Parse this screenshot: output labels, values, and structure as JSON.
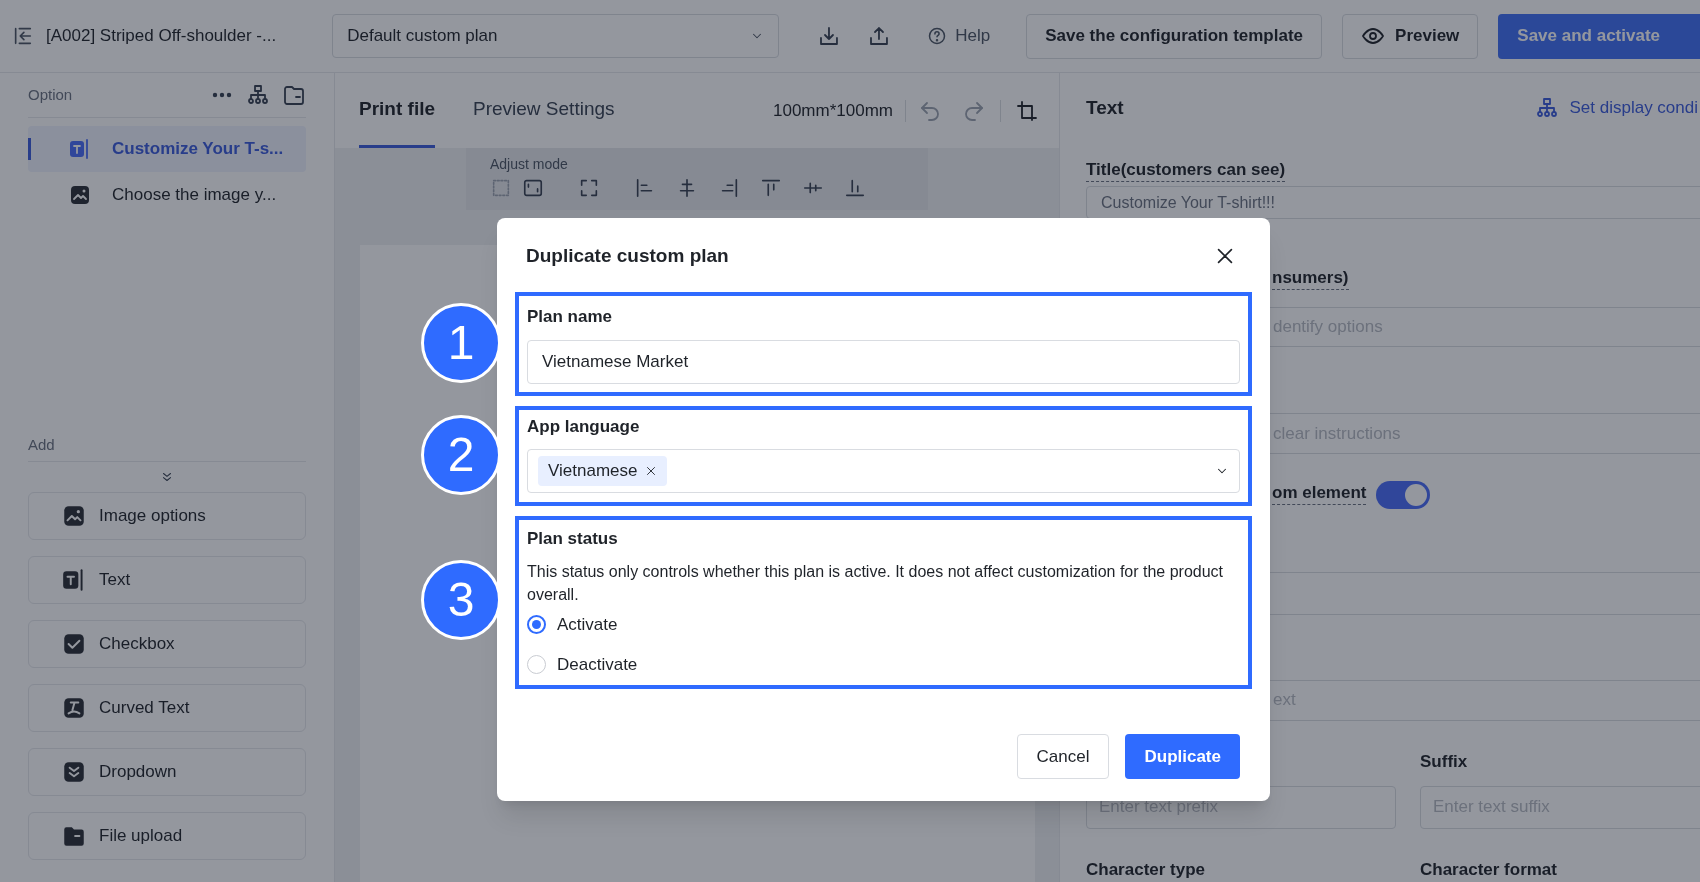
{
  "top_bar": {
    "title": "[A002] Striped Off-shoulder -...",
    "plan_select": "Default custom plan",
    "help": "Help",
    "buttons": [
      {
        "label": "Save the configuration template",
        "kind": "default"
      },
      {
        "label": "Preview",
        "kind": "preview"
      },
      {
        "label": "Save and activate",
        "kind": "primary"
      }
    ]
  },
  "sidebar": {
    "option_label": "Option",
    "options": [
      {
        "label": "Customize Your T-s...",
        "kind": "text",
        "selected": true
      },
      {
        "label": "Choose the image y...",
        "kind": "image",
        "selected": false
      }
    ],
    "add_label": "Add",
    "add_items": [
      {
        "label": "Image options",
        "kind": "image"
      },
      {
        "label": "Text",
        "kind": "text"
      },
      {
        "label": "Checkbox",
        "kind": "checkbox"
      },
      {
        "label": "Curved Text",
        "kind": "curved"
      },
      {
        "label": "Dropdown",
        "kind": "dropdown"
      },
      {
        "label": "File upload",
        "kind": "file"
      }
    ]
  },
  "editor": {
    "tabs": [
      {
        "label": "Print file",
        "selected": true
      },
      {
        "label": "Preview Settings",
        "selected": false
      }
    ],
    "size": "100mm*100mm",
    "adjust_mode": "Adjust mode"
  },
  "properties": {
    "title": "Text",
    "display_link": "Set display condi",
    "title_label": "Title(customers can see)",
    "title_value": "Customize Your T-shirt!!!",
    "label_2": "nsumers)",
    "placeholder_2": "dentify options",
    "placeholder_3": "clear instructions",
    "toggle_label": "om element",
    "toggle_on": true,
    "placeholder_4": "ext",
    "suffix_label": "Suffix",
    "prefix_placeholder": "Enter text prefix",
    "suffix_placeholder": "Enter text suffix",
    "character_type": "Character type",
    "character_format": "Character format"
  },
  "dialog": {
    "title": "Duplicate custom plan",
    "plan_name": {
      "label": "Plan name",
      "value": "Vietnamese Market"
    },
    "app_language": {
      "label": "App language",
      "tags": [
        "Vietnamese"
      ]
    },
    "plan_status": {
      "label": "Plan status",
      "description": "This status only controls whether this plan is active. It does not affect customization for the product overall.",
      "options": [
        {
          "label": "Activate",
          "selected": true
        },
        {
          "label": "Deactivate",
          "selected": false
        }
      ]
    },
    "cancel": "Cancel",
    "confirm": "Duplicate",
    "annotations": [
      "1",
      "2",
      "3"
    ]
  }
}
